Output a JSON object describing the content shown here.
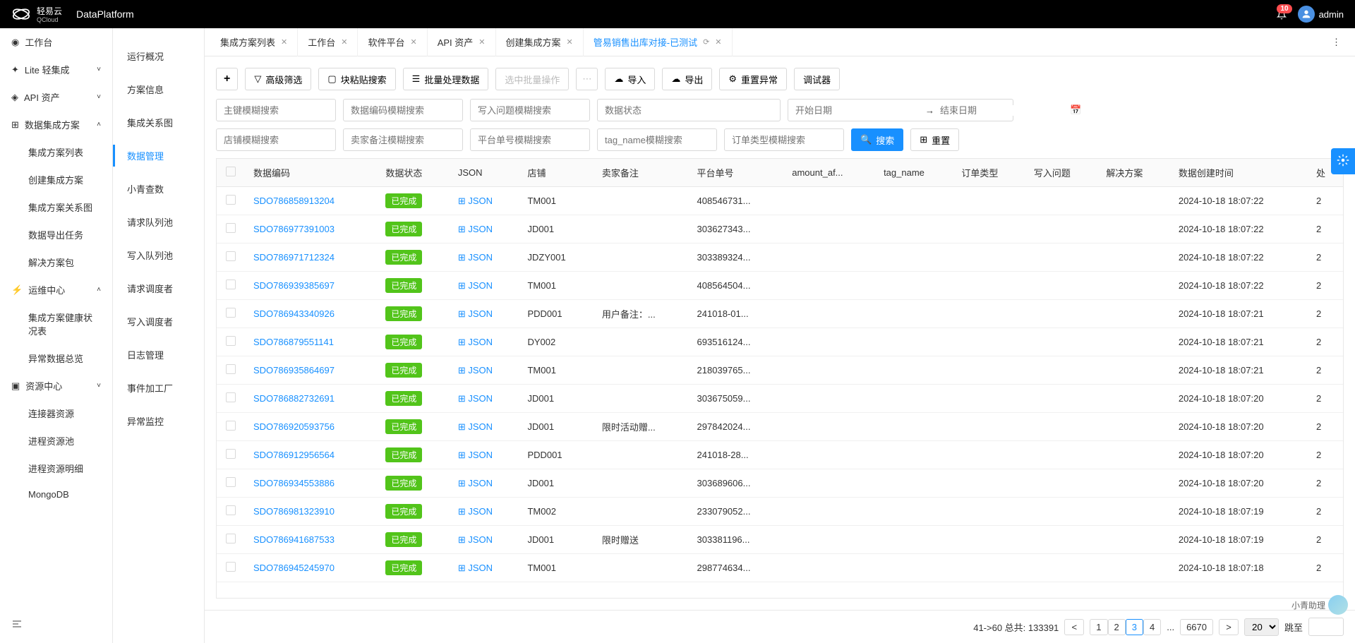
{
  "header": {
    "brand_main": "轻易云",
    "brand_sub": "QCloud",
    "platform": "DataPlatform",
    "notif_count": "10",
    "username": "admin"
  },
  "sidebar": {
    "items": [
      {
        "label": "工作台",
        "icon": "dashboard"
      },
      {
        "label": "Lite 轻集成",
        "icon": "lite",
        "expandable": true
      },
      {
        "label": "API 资产",
        "icon": "api",
        "expandable": true
      },
      {
        "label": "数据集成方案",
        "icon": "integration",
        "expanded": true,
        "children": [
          {
            "label": "集成方案列表"
          },
          {
            "label": "创建集成方案"
          },
          {
            "label": "集成方案关系图"
          },
          {
            "label": "数据导出任务"
          },
          {
            "label": "解决方案包"
          }
        ]
      },
      {
        "label": "运维中心",
        "icon": "ops",
        "expanded": true,
        "children": [
          {
            "label": "集成方案健康状况表"
          },
          {
            "label": "异常数据总览"
          }
        ]
      },
      {
        "label": "资源中心",
        "icon": "resource",
        "children": [
          {
            "label": "连接器资源"
          },
          {
            "label": "进程资源池"
          },
          {
            "label": "进程资源明细"
          },
          {
            "label": "MongoDB"
          }
        ]
      }
    ]
  },
  "sub_sidebar": {
    "items": [
      "运行概况",
      "方案信息",
      "集成关系图",
      "数据管理",
      "小青查数",
      "请求队列池",
      "写入队列池",
      "请求调度者",
      "写入调度者",
      "日志管理",
      "事件加工厂",
      "异常监控"
    ],
    "active": "数据管理"
  },
  "tabs": [
    {
      "label": "集成方案列表"
    },
    {
      "label": "工作台"
    },
    {
      "label": "软件平台"
    },
    {
      "label": "API 资产"
    },
    {
      "label": "创建集成方案"
    },
    {
      "label": "管易销售出库对接-已测试",
      "active": true,
      "refresh": true
    }
  ],
  "toolbar": {
    "add": "+",
    "filter": "高级筛选",
    "paste": "块粘贴搜索",
    "batch_data": "批量处理数据",
    "batch_op": "选中批量操作",
    "import": "导入",
    "export": "导出",
    "reset_ex": "重置异常",
    "debugger": "调试器"
  },
  "filters": {
    "r1": [
      "主键模糊搜索",
      "数据编码模糊搜索",
      "写入问题模糊搜索",
      "数据状态"
    ],
    "r2": [
      "店铺模糊搜索",
      "卖家备注模糊搜索",
      "平台单号模糊搜索",
      "tag_name模糊搜索",
      "订单类型模糊搜索"
    ],
    "date_start": "开始日期",
    "date_end": "结束日期",
    "search": "搜索",
    "reset": "重置"
  },
  "table": {
    "headers": [
      "数据编码",
      "数据状态",
      "JSON",
      "店铺",
      "卖家备注",
      "平台单号",
      "amount_af...",
      "tag_name",
      "订单类型",
      "写入问题",
      "解决方案",
      "数据创建时间",
      "处"
    ],
    "rows": [
      {
        "code": "SDO786858913204",
        "status": "已完成",
        "json": "JSON",
        "shop": "TM001",
        "remark": "",
        "order": "408546731...",
        "created": "2024-10-18 18:07:22"
      },
      {
        "code": "SDO786977391003",
        "status": "已完成",
        "json": "JSON",
        "shop": "JD001",
        "remark": "",
        "order": "303627343...",
        "created": "2024-10-18 18:07:22"
      },
      {
        "code": "SDO786971712324",
        "status": "已完成",
        "json": "JSON",
        "shop": "JDZY001",
        "remark": "",
        "order": "303389324...",
        "created": "2024-10-18 18:07:22"
      },
      {
        "code": "SDO786939385697",
        "status": "已完成",
        "json": "JSON",
        "shop": "TM001",
        "remark": "",
        "order": "408564504...",
        "created": "2024-10-18 18:07:22"
      },
      {
        "code": "SDO786943340926",
        "status": "已完成",
        "json": "JSON",
        "shop": "PDD001",
        "remark": "用户备注：...",
        "order": "241018-01...",
        "created": "2024-10-18 18:07:21"
      },
      {
        "code": "SDO786879551141",
        "status": "已完成",
        "json": "JSON",
        "shop": "DY002",
        "remark": "",
        "order": "693516124...",
        "created": "2024-10-18 18:07:21"
      },
      {
        "code": "SDO786935864697",
        "status": "已完成",
        "json": "JSON",
        "shop": "TM001",
        "remark": "",
        "order": "218039765...",
        "created": "2024-10-18 18:07:21"
      },
      {
        "code": "SDO786882732691",
        "status": "已完成",
        "json": "JSON",
        "shop": "JD001",
        "remark": "",
        "order": "303675059...",
        "created": "2024-10-18 18:07:20"
      },
      {
        "code": "SDO786920593756",
        "status": "已完成",
        "json": "JSON",
        "shop": "JD001",
        "remark": "限时活动赠...",
        "order": "297842024...",
        "created": "2024-10-18 18:07:20"
      },
      {
        "code": "SDO786912956564",
        "status": "已完成",
        "json": "JSON",
        "shop": "PDD001",
        "remark": "",
        "order": "241018-28...",
        "created": "2024-10-18 18:07:20"
      },
      {
        "code": "SDO786934553886",
        "status": "已完成",
        "json": "JSON",
        "shop": "JD001",
        "remark": "",
        "order": "303689606...",
        "created": "2024-10-18 18:07:20"
      },
      {
        "code": "SDO786981323910",
        "status": "已完成",
        "json": "JSON",
        "shop": "TM002",
        "remark": "",
        "order": "233079052...",
        "created": "2024-10-18 18:07:19"
      },
      {
        "code": "SDO786941687533",
        "status": "已完成",
        "json": "JSON",
        "shop": "JD001",
        "remark": "限时赠送",
        "order": "303381196...",
        "created": "2024-10-18 18:07:19"
      },
      {
        "code": "SDO786945245970",
        "status": "已完成",
        "json": "JSON",
        "shop": "TM001",
        "remark": "",
        "order": "298774634...",
        "created": "2024-10-18 18:07:18"
      }
    ]
  },
  "pagination": {
    "range": "41->60 总共: 133391",
    "pages": [
      "1",
      "2",
      "3",
      "4"
    ],
    "current": "3",
    "total_short": "6670",
    "page_size": "20",
    "jump_label": "跳至"
  },
  "assistant": "小青助理"
}
